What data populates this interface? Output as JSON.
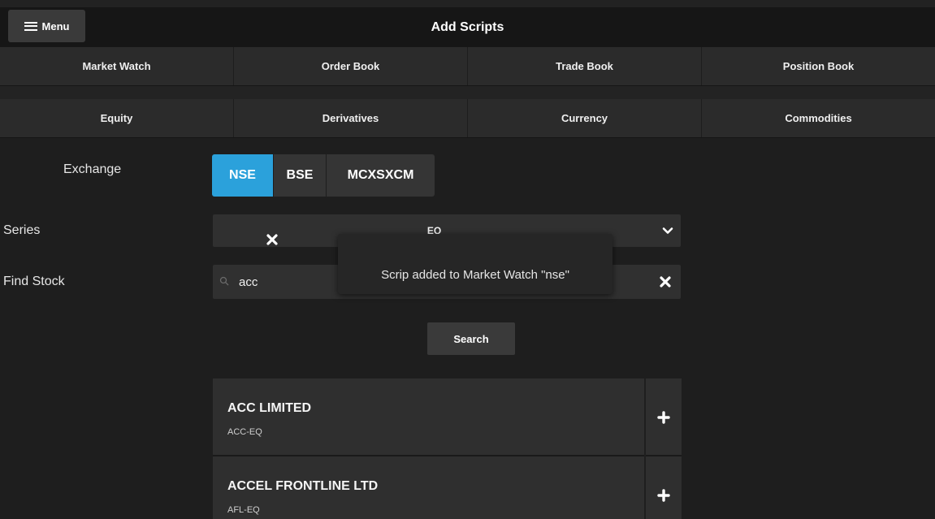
{
  "header": {
    "menu_label": "Menu",
    "title": "Add Scripts"
  },
  "primary_tabs": [
    {
      "label": "Market Watch"
    },
    {
      "label": "Order Book"
    },
    {
      "label": "Trade Book"
    },
    {
      "label": "Position Book"
    }
  ],
  "segment_tabs": [
    {
      "label": "Equity"
    },
    {
      "label": "Derivatives"
    },
    {
      "label": "Currency"
    },
    {
      "label": "Commodities"
    }
  ],
  "form": {
    "exchange_label": "Exchange",
    "exchanges": [
      {
        "label": "NSE",
        "selected": true
      },
      {
        "label": "BSE",
        "selected": false
      },
      {
        "label": "MCXSXCM",
        "selected": false
      }
    ],
    "series_label": "Series",
    "series_value": "EQ",
    "find_label": "Find Stock",
    "search_value": "acc",
    "search_button": "Search"
  },
  "results": [
    {
      "name": "ACC LIMITED",
      "code": "ACC-EQ"
    },
    {
      "name": "ACCEL FRONTLINE LTD",
      "code": "AFL-EQ"
    }
  ],
  "toast": {
    "message": "Scrip added to Market Watch \"nse\""
  },
  "colors": {
    "accent": "#2ba1db",
    "background": "#1e1e1e",
    "panel": "#2f2f2f"
  },
  "icons": {
    "menu": "hamburger-icon",
    "series_dropdown": "chevron-down-icon",
    "search": "search-icon",
    "clear": "close-icon",
    "toast_close": "close-icon",
    "add": "plus-icon"
  }
}
